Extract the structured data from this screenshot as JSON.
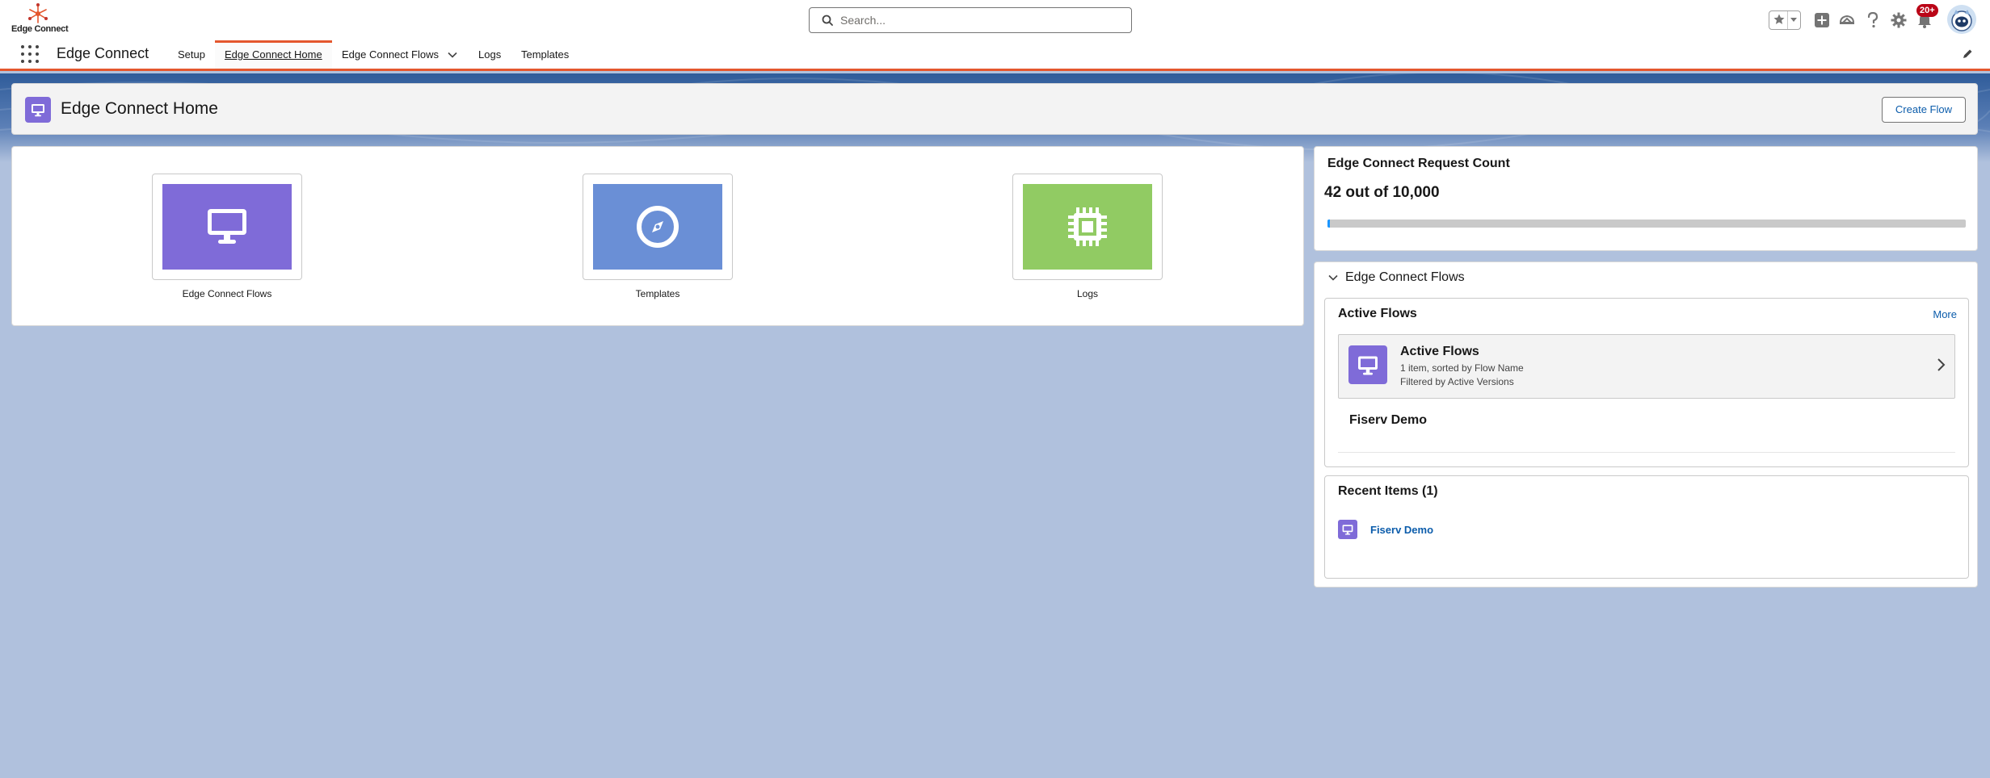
{
  "header": {
    "logo_text": "Edge Connect",
    "search_placeholder": "Search...",
    "notification_count": "20+"
  },
  "nav": {
    "app_name": "Edge Connect",
    "items": [
      {
        "label": "Setup"
      },
      {
        "label": "Edge Connect Home"
      },
      {
        "label": "Edge Connect Flows"
      },
      {
        "label": "Logs"
      },
      {
        "label": "Templates"
      }
    ]
  },
  "page": {
    "title": "Edge Connect Home",
    "create_button": "Create Flow"
  },
  "tiles": [
    {
      "label": "Edge Connect Flows",
      "color": "#7f6bd8",
      "icon": "desktop-icon"
    },
    {
      "label": "Templates",
      "color": "#6a8fd6",
      "icon": "compass-icon"
    },
    {
      "label": "Logs",
      "color": "#91cb63",
      "icon": "chip-icon"
    }
  ],
  "request_count": {
    "title": "Edge Connect Request Count",
    "value": "42 out of 10,000",
    "used": 42,
    "limit": 10000
  },
  "flows_section": {
    "title": "Edge Connect Flows",
    "active_flows": {
      "title": "Active Flows",
      "more": "More",
      "list_title": "Active Flows",
      "list_subtitle": "1 item, sorted by Flow Name",
      "list_filter": "Filtered by Active Versions",
      "item": "Fiserv Demo"
    },
    "recent": {
      "title": "Recent Items (1)",
      "item": "Fiserv Demo"
    }
  },
  "colors": {
    "accent": "#e4572e",
    "link": "#0b5cab",
    "flow_purple": "#7f6bd8"
  }
}
